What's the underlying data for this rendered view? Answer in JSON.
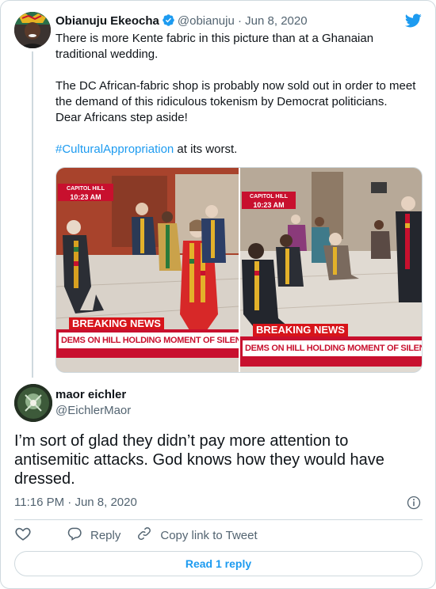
{
  "original_tweet": {
    "author_name": "Obianuju Ekeocha",
    "handle": "@obianuju",
    "separator": "·",
    "date": "Jun 8, 2020",
    "lines": [
      "There is more Kente fabric in this picture than at a Ghanaian",
      "traditional wedding.",
      "",
      "The DC African-fabric shop is probably now sold out in order to meet",
      "the demand of this ridiculous tokenism by Democrat politicians.",
      "Dear Africans step aside!",
      ""
    ],
    "hashtag": "#CulturalAppropriation",
    "tail": " at its worst.",
    "media": {
      "left": {
        "tag_top": "CAPITOL HILL",
        "tag_time": "10:23 AM",
        "breaking": "BREAKING NEWS",
        "banner": "DEMS ON HILL HOLDING MOMENT OF SILENCE"
      },
      "right": {
        "tag_top": "CAPITOL HILL",
        "tag_time": "10:23 AM",
        "breaking": "BREAKING NEWS",
        "banner": "DEMS ON HILL HOLDING MOMENT OF SILENCE I"
      }
    }
  },
  "reply_tweet": {
    "author_name": "maor eichler",
    "handle": "@EichlerMaor",
    "text": "I’m sort of glad they didn’t pay more attention to antisemitic attacks. God knows how they would have dressed.",
    "time": "11:16 PM",
    "separator": "·",
    "date": "Jun 8, 2020"
  },
  "actions": {
    "reply_label": "Reply",
    "copy_label": "Copy link to Tweet"
  },
  "read_replies_label": "Read 1 reply",
  "colors": {
    "accent": "#1d9bf0",
    "text": "#0f1419",
    "muted": "#536471",
    "border": "#cfd9de",
    "news_red": "#c8102e"
  },
  "icons": [
    "verified-badge-icon",
    "twitter-bird-icon",
    "info-icon",
    "heart-icon",
    "reply-icon",
    "link-icon"
  ]
}
